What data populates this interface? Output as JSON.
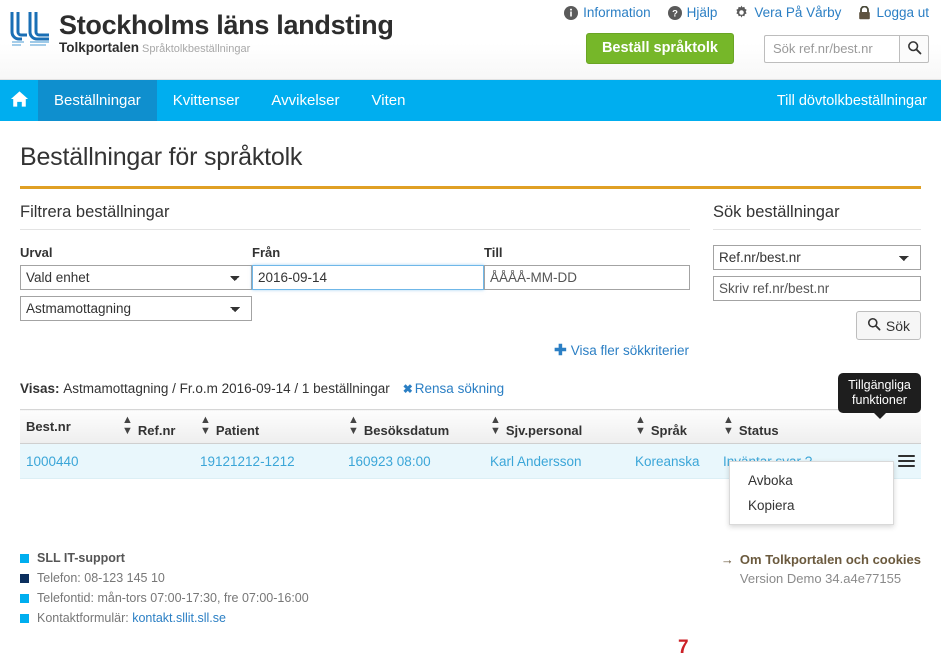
{
  "header": {
    "brand_title": "Stockholms läns landsting",
    "brand_sub_bold": "Tolkportalen",
    "brand_sub_light": "Språktolkbeställningar",
    "logo_icon": "sll-logo-icon",
    "links": [
      {
        "label": "Information",
        "icon": "info-circle-icon"
      },
      {
        "label": "Hjälp",
        "icon": "question-circle-icon"
      },
      {
        "label": "Vera På Vårby",
        "icon": "gear-icon"
      },
      {
        "label": "Logga ut",
        "icon": "lock-icon"
      }
    ],
    "order_button": "Beställ språktolk",
    "search_placeholder": "Sök ref.nr/best.nr",
    "search_value": "",
    "search_icon": "search-icon"
  },
  "nav": {
    "home_icon": "home-icon",
    "items": [
      {
        "label": "Beställningar",
        "active": true
      },
      {
        "label": "Kvittenser",
        "active": false
      },
      {
        "label": "Avvikelser",
        "active": false
      },
      {
        "label": "Viten",
        "active": false
      }
    ],
    "right_link": "Till dövtolkbeställningar"
  },
  "page": {
    "title": "Beställningar för språktolk",
    "filter_heading": "Filtrera beställningar",
    "search_heading": "Sök beställningar"
  },
  "filter": {
    "urval_label": "Urval",
    "urval_value": "Vald enhet",
    "urval_options": [
      "Vald enhet"
    ],
    "unit_value": "Astmamottagning",
    "unit_options": [
      "Astmamottagning"
    ],
    "fran_label": "Från",
    "fran_value": "2016-09-14",
    "fran_placeholder": "ÅÅÅÅ-MM-DD",
    "till_label": "Till",
    "till_value": "",
    "till_placeholder": "ÅÅÅÅ-MM-DD",
    "more_criteria": "Visa fler sökkriterier",
    "more_icon": "plus-icon"
  },
  "search_panel": {
    "type_value": "Ref.nr/best.nr",
    "type_options": [
      "Ref.nr/best.nr"
    ],
    "query_value": "",
    "query_placeholder": "Skriv ref.nr/best.nr",
    "button_label": "Sök",
    "button_icon": "search-icon"
  },
  "summary": {
    "prefix": "Visas:",
    "text": "Astmamottagning / Fr.o.m 2016-09-14 / 1 beställningar",
    "clear_label": "Rensa sökning",
    "clear_icon": "x-icon"
  },
  "table": {
    "columns": [
      {
        "label": "Best.nr",
        "sortable": false
      },
      {
        "label": "Ref.nr",
        "sortable": true
      },
      {
        "label": "Patient",
        "sortable": true
      },
      {
        "label": "Besöksdatum",
        "sortable": true
      },
      {
        "label": "Sjv.personal",
        "sortable": true
      },
      {
        "label": "Språk",
        "sortable": true
      },
      {
        "label": "Status",
        "sortable": true
      }
    ],
    "rows": [
      {
        "best_nr": "1000440",
        "ref_nr": "",
        "patient": "19121212-1212",
        "besoksdatum": "160923 08:00",
        "sjv_personal": "Karl Andersson",
        "sprak": "Koreanska",
        "status": "Inväntar svar ?",
        "action_icon": "hamburger-menu-icon"
      }
    ]
  },
  "tooltip": {
    "line1": "Tillgängliga",
    "line2": "funktioner"
  },
  "dropdown": {
    "items": [
      "Avboka",
      "Kopiera"
    ]
  },
  "annotation": {
    "marker": "7"
  },
  "footer": {
    "support_title": "SLL IT-support",
    "phone": "Telefon: 08-123 145 10",
    "hours": "Telefontid: mån-tors 07:00-17:30, fre 07:00-16:00",
    "contact_label": "Kontaktformulär:",
    "contact_link": "kontakt.sllit.sll.se",
    "about": "Om Tolkportalen och cookies",
    "about_icon": "arrow-right-icon",
    "version": "Version Demo 34.a4e77155"
  }
}
